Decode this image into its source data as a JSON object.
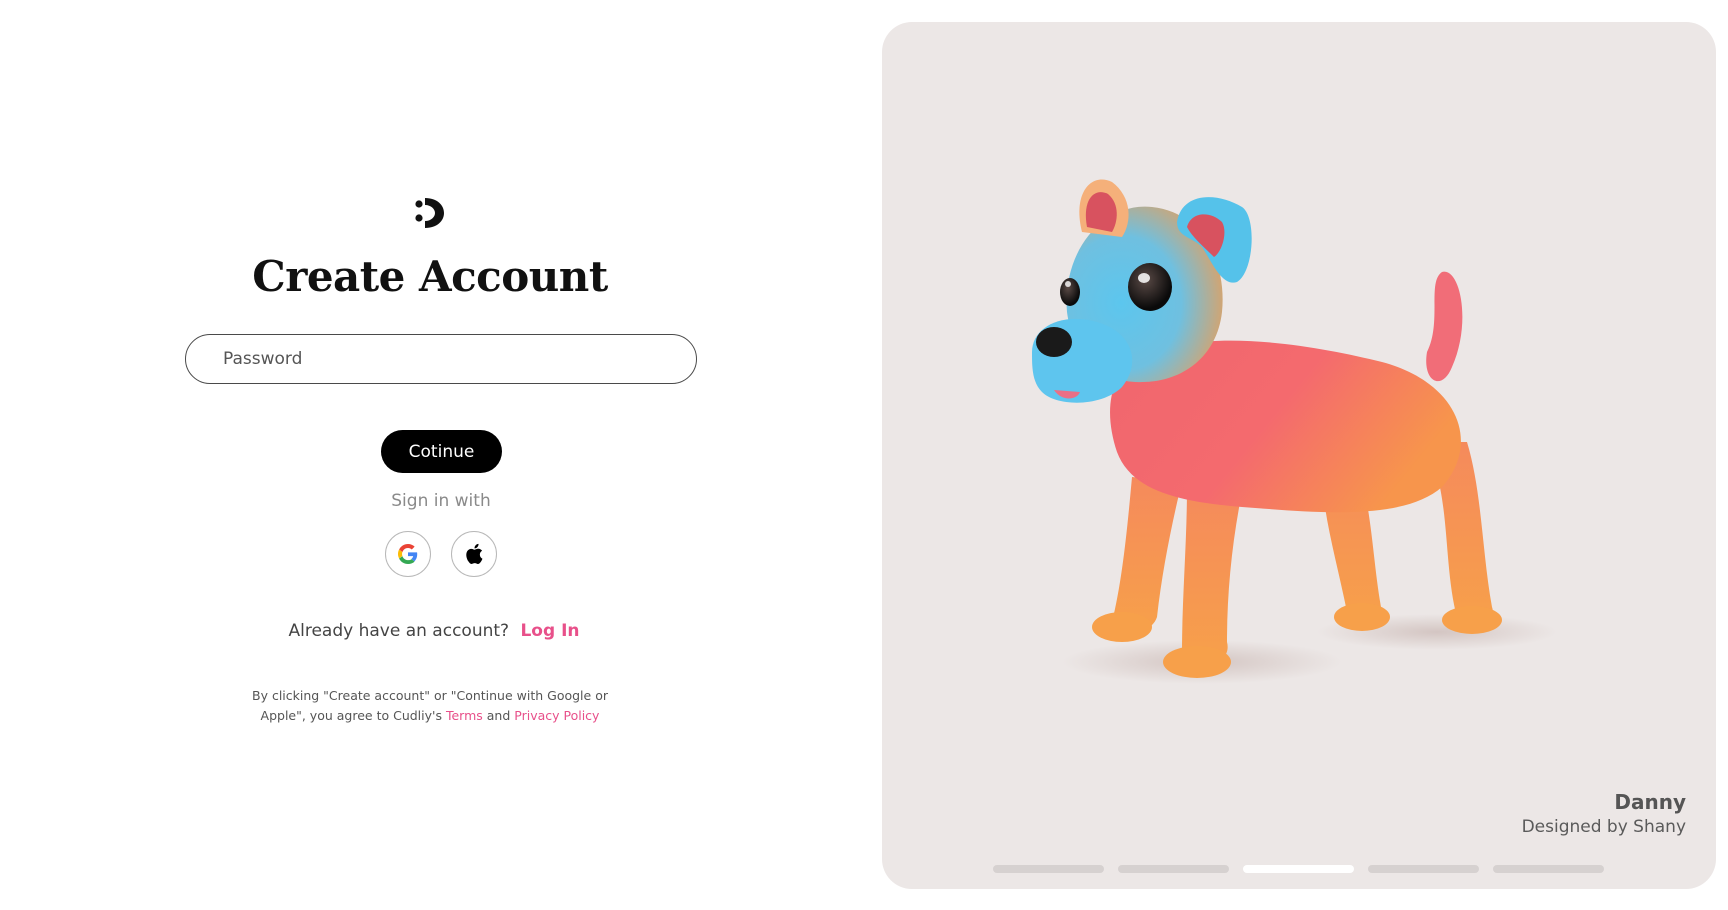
{
  "form": {
    "title": "Create Account",
    "password_placeholder": "Password",
    "continue_label": "Cotinue",
    "signin_with": "Sign in with",
    "social": [
      {
        "name": "Google",
        "icon": "google-icon"
      },
      {
        "name": "Apple",
        "icon": "apple-icon"
      }
    ],
    "login_prompt": "Already have an account?",
    "login_link": "Log In",
    "legal_prefix": "By clicking \"Create account\" or \"Continue with Google or Apple\", you agree to Cudliy's",
    "legal_terms": "Terms",
    "legal_and": "and",
    "legal_privacy": "Privacy Policy"
  },
  "showcase": {
    "name": "Danny",
    "designer": "Designed by Shany",
    "slides_total": 5,
    "active_slide": 3
  },
  "colors": {
    "accent": "#e8508a",
    "button": "#000000",
    "showcase_bg": "#ece7e6"
  }
}
